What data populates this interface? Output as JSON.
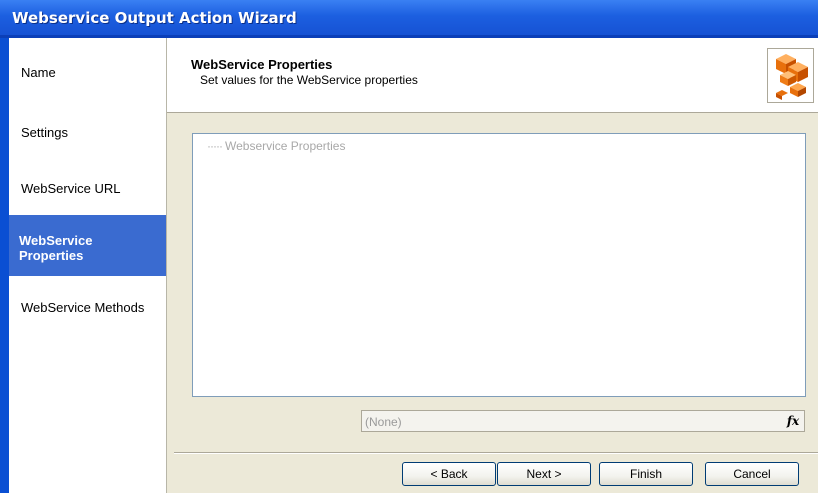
{
  "window": {
    "title": "Webservice Output Action Wizard"
  },
  "steps": [
    {
      "label": "Name",
      "active": false
    },
    {
      "label": "Settings",
      "active": false
    },
    {
      "label": "WebService URL",
      "active": false
    },
    {
      "label": "WebService Properties",
      "active": true
    },
    {
      "label": "WebService Methods",
      "active": false
    }
  ],
  "header": {
    "title": "WebService Properties",
    "subtitle": "Set values for the WebService properties",
    "icon": "orange-cubes-icon"
  },
  "tree": {
    "root_label": "Webservice Properties"
  },
  "expression": {
    "value": "(None)",
    "fx_label": "fx"
  },
  "buttons": {
    "back": "< Back",
    "next": "Next >",
    "finish": "Finish",
    "cancel": "Cancel"
  },
  "colors": {
    "title_bar": "#1c5fe0",
    "active_step": "#3a6bd0",
    "dialog_bg": "#ece9d8"
  }
}
